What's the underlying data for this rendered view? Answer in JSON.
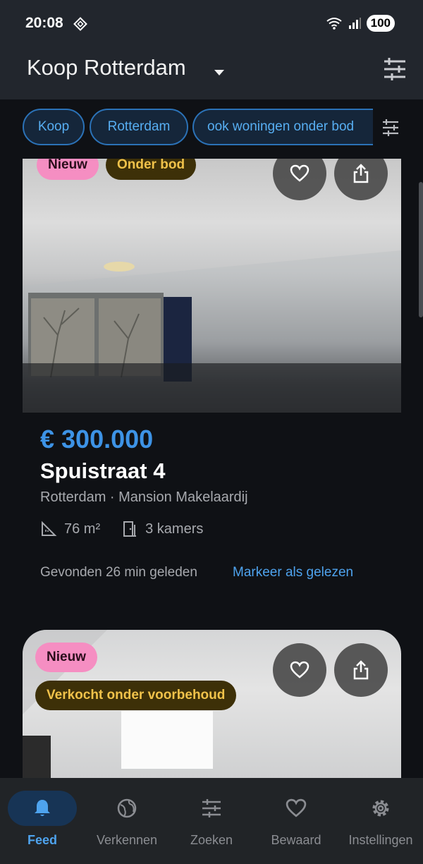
{
  "status": {
    "time": "20:08",
    "battery": "100",
    "network": "5"
  },
  "appbar": {
    "title": "Koop Rotterdam"
  },
  "chips": [
    "Koop",
    "Rotterdam",
    "ook woningen onder bod"
  ],
  "listings": [
    {
      "badges": [
        "Nieuw",
        "Onder bod"
      ],
      "price": "€ 300.000",
      "street": "Spuistraat 4",
      "place": "Rotterdam · Mansion Makelaardij",
      "area": "76 m²",
      "rooms": "3 kamers",
      "found": "Gevonden 26 min geleden",
      "mark_read": "Markeer als gelezen"
    },
    {
      "badges": [
        "Nieuw",
        "Verkocht onder voorbehoud"
      ]
    }
  ],
  "nav": [
    {
      "label": "Feed",
      "icon": "bell-icon",
      "active": true
    },
    {
      "label": "Verkennen",
      "icon": "globe-icon",
      "active": false
    },
    {
      "label": "Zoeken",
      "icon": "sliders-icon",
      "active": false
    },
    {
      "label": "Bewaard",
      "icon": "heart-icon",
      "active": false
    },
    {
      "label": "Instellingen",
      "icon": "gear-icon",
      "active": false
    }
  ],
  "colors": {
    "accent": "#4ea3ee",
    "price": "#3d93e6",
    "badge_new": "#f58ec2",
    "badge_bid_text": "#f0c24a",
    "background": "#0f1115"
  }
}
